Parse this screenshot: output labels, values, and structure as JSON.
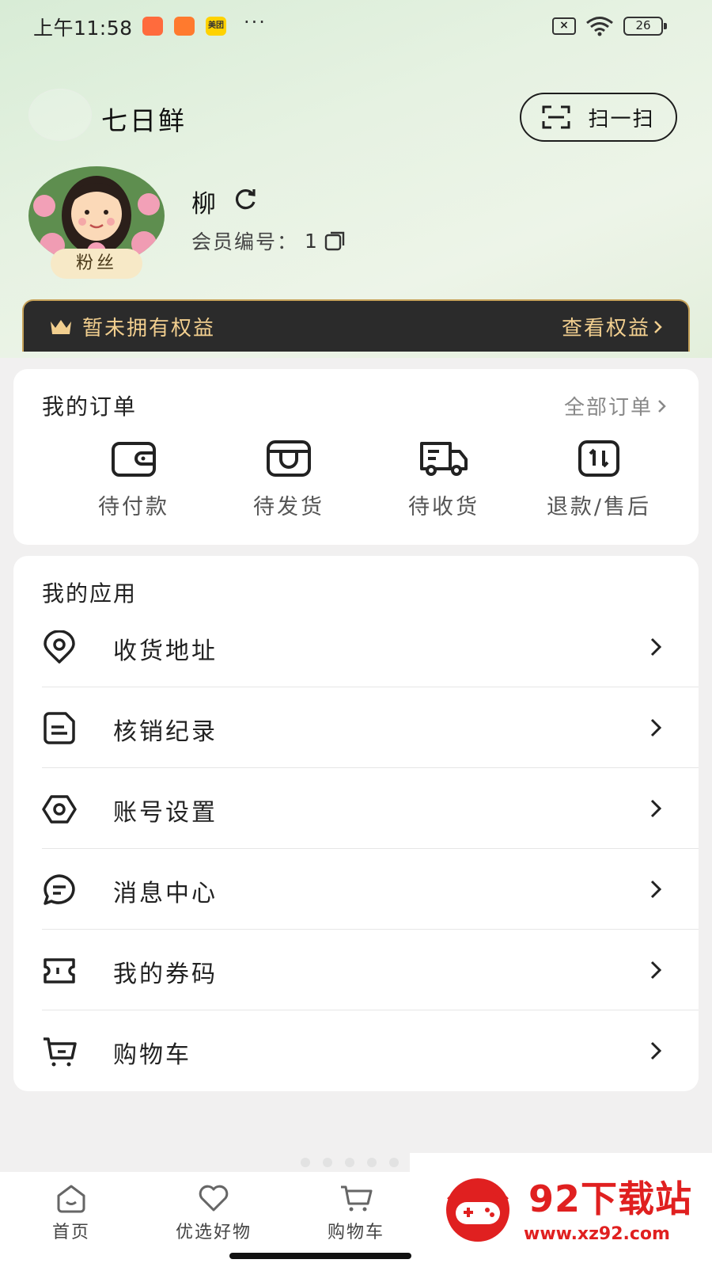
{
  "status_bar": {
    "time": "上午11:58",
    "app3_label": "美团",
    "more": "···",
    "battery": "26"
  },
  "store": {
    "name": "七日鲜",
    "scan_label": "扫一扫"
  },
  "profile": {
    "fan_badge": "粉丝",
    "name": "柳",
    "member_label": "会员编号：",
    "member_value": "1"
  },
  "benefits": {
    "text": "暂未拥有权益",
    "link": "查看权益"
  },
  "orders": {
    "title": "我的订单",
    "all_label": "全部订单",
    "items": [
      {
        "label": "待付款",
        "icon": "wallet-icon"
      },
      {
        "label": "待发货",
        "icon": "box-icon"
      },
      {
        "label": "待收货",
        "icon": "truck-icon"
      },
      {
        "label": "退款/售后",
        "icon": "refund-icon"
      }
    ]
  },
  "apps": {
    "title": "我的应用",
    "items": [
      {
        "label": "收货地址",
        "icon": "location-icon"
      },
      {
        "label": "核销纪录",
        "icon": "note-icon"
      },
      {
        "label": "账号设置",
        "icon": "settings-icon"
      },
      {
        "label": "消息中心",
        "icon": "chat-icon"
      },
      {
        "label": "我的券码",
        "icon": "ticket-icon"
      },
      {
        "label": "购物车",
        "icon": "cart-icon"
      }
    ]
  },
  "tabs": [
    {
      "label": "首页",
      "icon": "home-icon"
    },
    {
      "label": "优选好物",
      "icon": "heart-icon"
    },
    {
      "label": "购物车",
      "icon": "cart-icon"
    }
  ],
  "watermark": {
    "title": "92下载站",
    "url": "www.xz92.com"
  },
  "colors": {
    "benefit_bg": "#2b2b2b",
    "benefit_text": "#f2cf8f",
    "watermark_red": "#e02020"
  }
}
